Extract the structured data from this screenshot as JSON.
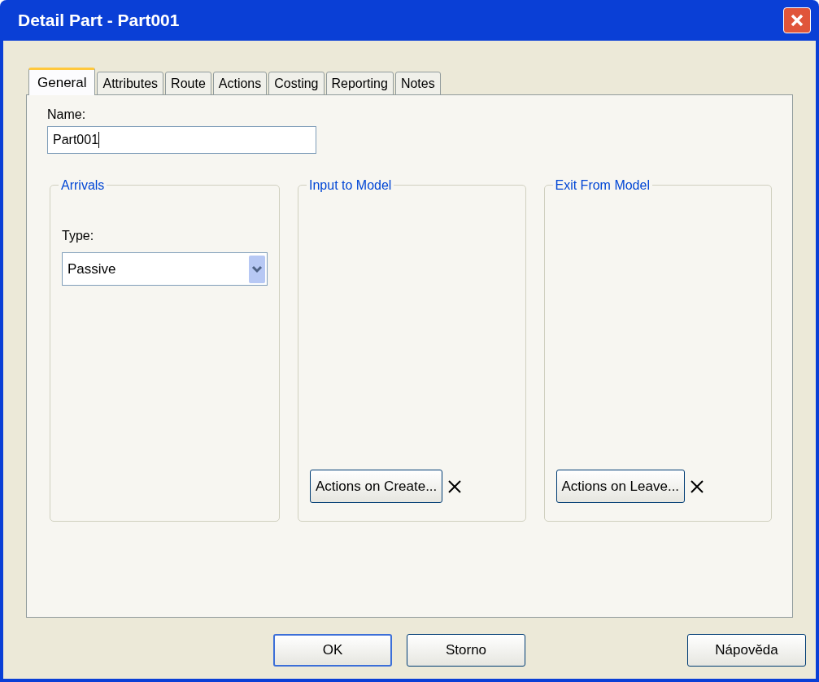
{
  "window": {
    "title": "Detail Part - Part001"
  },
  "tabs": [
    {
      "label": "General",
      "selected": true
    },
    {
      "label": "Attributes",
      "selected": false
    },
    {
      "label": "Route",
      "selected": false
    },
    {
      "label": "Actions",
      "selected": false
    },
    {
      "label": "Costing",
      "selected": false
    },
    {
      "label": "Reporting",
      "selected": false
    },
    {
      "label": "Notes",
      "selected": false
    }
  ],
  "name_field": {
    "label": "Name:",
    "value": "Part001"
  },
  "groups": [
    {
      "kind": "combo",
      "title": "Arrivals",
      "label": "Type:",
      "value": "Passive"
    },
    {
      "kind": "action",
      "title": "Input to Model",
      "button": "Actions on Create..."
    },
    {
      "kind": "action",
      "title": "Exit From Model",
      "button": "Actions on Leave..."
    }
  ],
  "buttons": [
    {
      "label": "OK",
      "kind": "default"
    },
    {
      "label": "Storno",
      "kind": "normal"
    },
    {
      "label": "Nápověda",
      "kind": "help"
    }
  ]
}
